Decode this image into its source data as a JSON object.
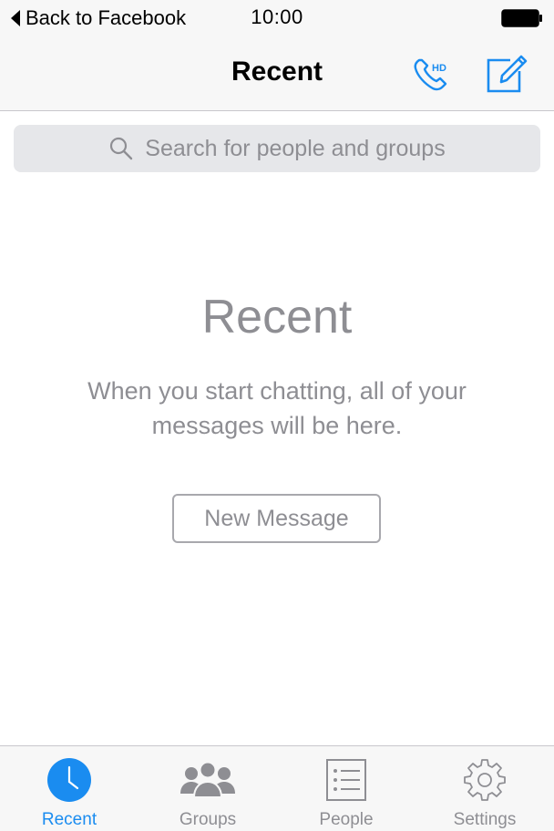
{
  "status_bar": {
    "back_label": "Back to Facebook",
    "time": "10:00"
  },
  "nav": {
    "title": "Recent",
    "call_icon": "hd-phone-icon",
    "compose_icon": "compose-icon"
  },
  "search": {
    "placeholder": "Search for people and groups"
  },
  "empty_state": {
    "title": "Recent",
    "message": "When you start chatting, all of your messages will be here.",
    "button_label": "New Message"
  },
  "tabs": [
    {
      "label": "Recent",
      "icon": "clock-icon",
      "active": true
    },
    {
      "label": "Groups",
      "icon": "group-icon",
      "active": false
    },
    {
      "label": "People",
      "icon": "list-icon",
      "active": false
    },
    {
      "label": "Settings",
      "icon": "gear-icon",
      "active": false
    }
  ],
  "colors": {
    "accent": "#1a8cf0",
    "muted_text": "#8e8e93",
    "bar_background": "#f7f7f7",
    "search_background": "#e6e7ea"
  }
}
